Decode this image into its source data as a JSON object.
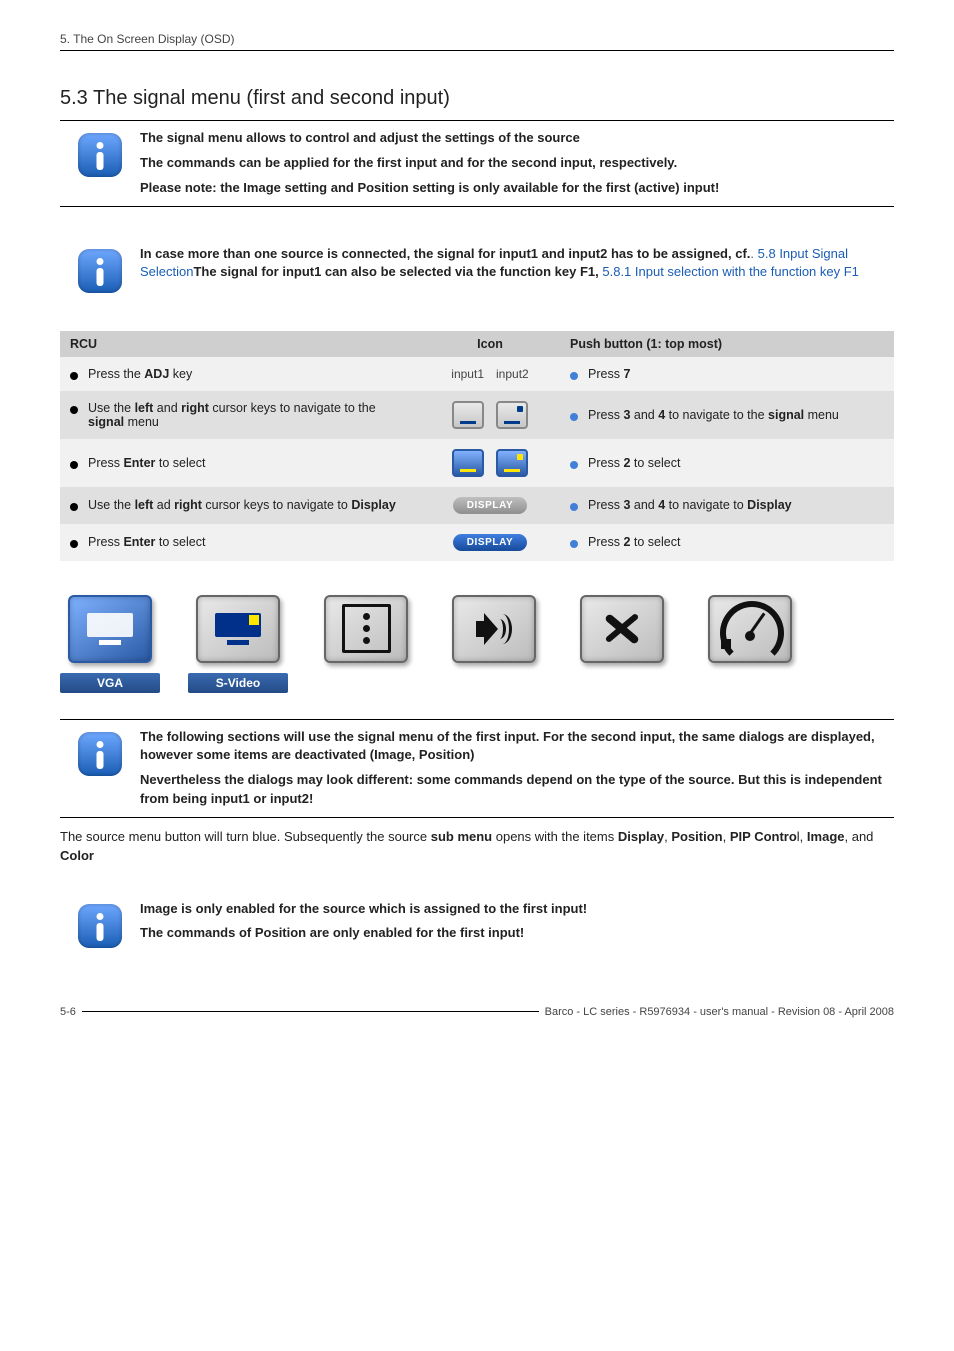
{
  "breadcrumb": "5. The On Screen Display (OSD)",
  "section_title": "5.3 The signal menu (first and second input)",
  "info1": {
    "l1": "The signal menu allows to control and adjust the settings of the source",
    "l2": "The commands can be applied for the first input and for the second input, respectively.",
    "l3": "Please note: the Image setting and Position setting is only available for the first (active) input!"
  },
  "info2": {
    "pre": "In case more than one source is connected, the signal for input1 and input2 has to be assigned, cf.",
    "link1": ". 5.8 Input Signal Selection",
    "mid": "The signal for input1 can also be selected via the function key F1, ",
    "link2": "5.8.1 Input selection with the function key F1"
  },
  "table": {
    "h1": "RCU",
    "h2": "Icon",
    "h3": "Push button (1: top most)",
    "icon_input1": "input1",
    "icon_input2": "input2",
    "r1": {
      "rcu_a": "Press the ",
      "rcu_b": "ADJ",
      "rcu_c": " key",
      "push_a": "Press ",
      "push_b": "7"
    },
    "r2": {
      "rcu_a": "Use the ",
      "rcu_b": "left",
      "rcu_c": " and ",
      "rcu_d": "right",
      "rcu_e": " cursor keys to navigate to the ",
      "rcu_f": "signal",
      "rcu_g": " menu",
      "push_a": "Press ",
      "push_b": "3",
      "push_c": " and ",
      "push_d": "4",
      "push_e": " to navigate to the ",
      "push_f": "signal",
      "push_g": " menu"
    },
    "r3": {
      "rcu_a": "Press ",
      "rcu_b": "Enter",
      "rcu_c": " to select",
      "push_a": "Press ",
      "push_b": "2",
      "push_c": " to select"
    },
    "r4": {
      "rcu_a": "Use the ",
      "rcu_b": "left",
      "rcu_c": " ad ",
      "rcu_d": "right",
      "rcu_e": " cursor keys to navigate to ",
      "rcu_f": "Display",
      "push_a": "Press ",
      "push_b": "3",
      "push_c": " and ",
      "push_d": "4",
      "push_e": " to navigate to ",
      "push_f": "Display",
      "pill": "DISPLAY"
    },
    "r5": {
      "rcu_a": "Press ",
      "rcu_b": "Enter",
      "rcu_c": " to select",
      "push_a": "Press ",
      "push_b": "2",
      "push_c": " to select",
      "pill": "DISPLAY"
    }
  },
  "osd_labels": {
    "l1": "VGA",
    "l2": "S-Video"
  },
  "info3": {
    "l1": "The following sections will use the signal menu of the first input. For the second input, the same dialogs are displayed, however some items are deactivated (Image, Position)",
    "l2": "Nevertheless the dialogs may look different: some commands depend on the type of the source. But this is independent from being input1 or input2!"
  },
  "paragraph": {
    "a": "The source menu button will turn blue. Subsequently the source ",
    "b": "sub menu",
    "c": " opens with the items ",
    "d": "Display",
    "e": ", ",
    "f": "Position",
    "g": ", ",
    "h": "PIP Contro",
    "i": "l, ",
    "j": "Image",
    "k": ", and ",
    "l": "Color"
  },
  "info4": {
    "l1": "Image is only enabled for the source which is assigned to the first input!",
    "l2": "The commands of Position are only enabled for the first input!"
  },
  "footer": {
    "page": "5-6",
    "text": "Barco - LC series - R5976934 - user's manual - Revision 08 - April 2008"
  }
}
